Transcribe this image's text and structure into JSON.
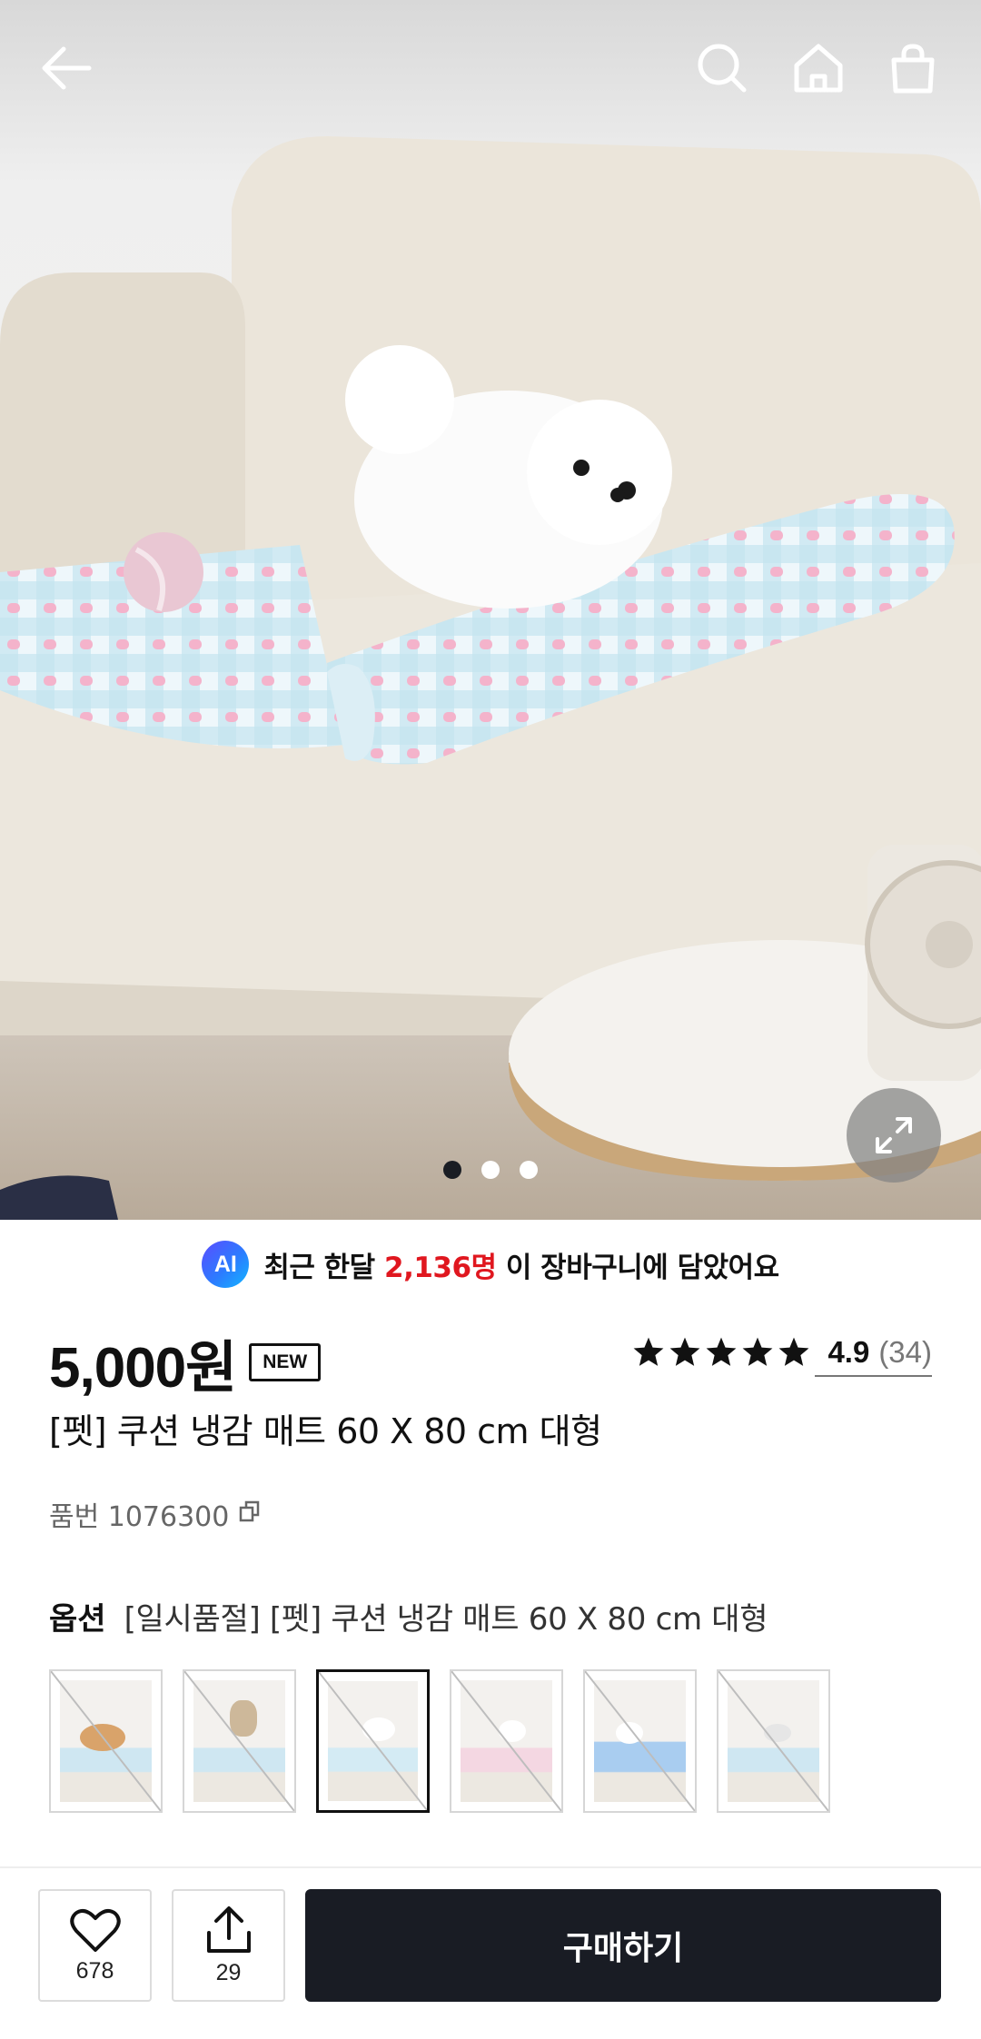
{
  "header": {
    "back_icon": "arrow-left-icon",
    "search_icon": "search-icon",
    "home_icon": "home-icon",
    "cart_icon": "shopping-bag-icon"
  },
  "gallery": {
    "image_count": 3,
    "active_index": 0,
    "expand_icon": "expand-icon"
  },
  "ai_notice": {
    "badge": "AI",
    "prefix": "최근 한달 ",
    "highlight": "2,136명",
    "suffix": " 이 장바구니에 담았어요",
    "highlight_color": "#e0171f"
  },
  "product": {
    "price": "5,000원",
    "badge": "NEW",
    "rating": "4.9",
    "review_count": "(34)",
    "star_count": 5,
    "title": "[펫] 쿠션 냉감 매트 60 X 80 cm 대형",
    "sku": "품번 1076300",
    "copy_icon": "copy-icon"
  },
  "options": {
    "label": "옵션",
    "selected": "[일시품절] [펫] 쿠션 냉감 매트 60 X 80 cm 대형",
    "selected_thumb_index": 2,
    "thumbs_sold_out": [
      true,
      true,
      true,
      true,
      true,
      true
    ]
  },
  "actions": {
    "like_count": "678",
    "share_count": "29",
    "buy_label": "구매하기",
    "buy_color": "#191c24"
  }
}
